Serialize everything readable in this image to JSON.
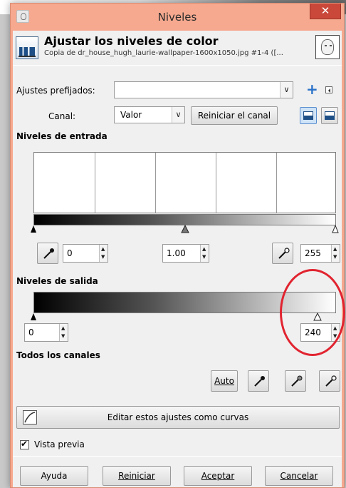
{
  "window": {
    "title": "Niveles",
    "close_glyph": "✕"
  },
  "header": {
    "title": "Ajustar los niveles de color",
    "subtitle": "Copia de dr_house_hugh_laurie-wallpaper-1600x1050.jpg #1-4 ([..."
  },
  "presets": {
    "label": "Ajustes prefijados:",
    "value": "",
    "dropdown_glyph": "∨"
  },
  "channel": {
    "label": "Canal:",
    "value": "Valor",
    "dropdown_glyph": "∨",
    "reset_label": "Reiniciar el canal"
  },
  "input_levels": {
    "label": "Niveles de entrada",
    "black": "0",
    "gamma": "1.00",
    "white": "255"
  },
  "output_levels": {
    "label": "Niveles de salida",
    "low": "0",
    "high": "240"
  },
  "all_channels": {
    "label": "Todos los canales",
    "auto_label": "Auto"
  },
  "curves_button": {
    "label": "Editar estos ajustes como curvas"
  },
  "preview": {
    "label": "Vista previa",
    "checked": true
  },
  "buttons": {
    "help": "Ayuda",
    "reset": "Reiniciar",
    "accept": "Aceptar",
    "cancel": "Cancelar"
  },
  "colors": {
    "titlebar": "#f6a98f",
    "close_button": "#c9483a",
    "annotation_circle": "#e12430",
    "accent": "#2a72c9"
  },
  "icons": {
    "plus": "+",
    "spin_up": "▲",
    "spin_down": "▼"
  }
}
